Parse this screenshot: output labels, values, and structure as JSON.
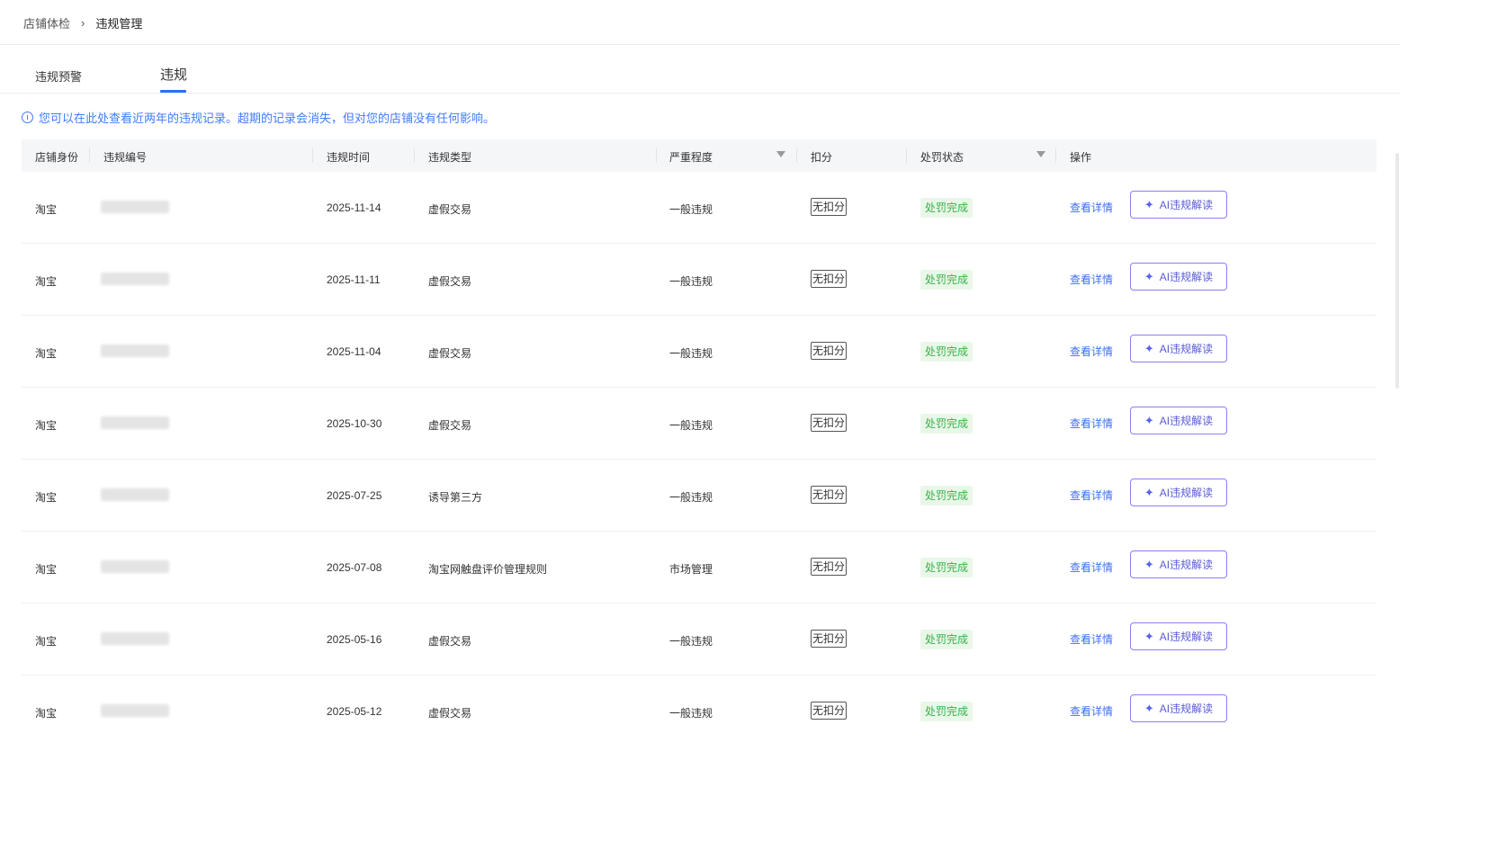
{
  "breadcrumb": {
    "parent": "店铺体检",
    "separator": "›",
    "current": "违规管理"
  },
  "tabs": [
    {
      "label": "违规预警"
    },
    {
      "label": "违规"
    }
  ],
  "notice": {
    "text": "您可以在此处查看近两年的违规记录。超期的记录会消失，但对您的店铺没有任何影响。"
  },
  "table": {
    "headers": {
      "identity": "店铺身份",
      "code": "违规编号",
      "time": "违规时间",
      "type": "违规类型",
      "severity": "严重程度",
      "points": "扣分",
      "penalty": "处罚状态",
      "action": "操作"
    },
    "rows": [
      {
        "identity": "淘宝",
        "time": "2025-11-14",
        "type": "虚假交易",
        "severity": "一般违规",
        "points": "无扣分",
        "penalty": "处罚完成",
        "detail": "查看详情",
        "ai": "AI违规解读"
      },
      {
        "identity": "淘宝",
        "time": "2025-11-11",
        "type": "虚假交易",
        "severity": "一般违规",
        "points": "无扣分",
        "penalty": "处罚完成",
        "detail": "查看详情",
        "ai": "AI违规解读"
      },
      {
        "identity": "淘宝",
        "time": "2025-11-04",
        "type": "虚假交易",
        "severity": "一般违规",
        "points": "无扣分",
        "penalty": "处罚完成",
        "detail": "查看详情",
        "ai": "AI违规解读"
      },
      {
        "identity": "淘宝",
        "time": "2025-10-30",
        "type": "虚假交易",
        "severity": "一般违规",
        "points": "无扣分",
        "penalty": "处罚完成",
        "detail": "查看详情",
        "ai": "AI违规解读"
      },
      {
        "identity": "淘宝",
        "time": "2025-07-25",
        "type": "诱导第三方",
        "severity": "一般违规",
        "points": "无扣分",
        "penalty": "处罚完成",
        "detail": "查看详情",
        "ai": "AI违规解读"
      },
      {
        "identity": "淘宝",
        "time": "2025-07-08",
        "type": "淘宝网触盘评价管理规则",
        "severity": "市场管理",
        "points": "无扣分",
        "penalty": "处罚完成",
        "detail": "查看详情",
        "ai": "AI违规解读"
      },
      {
        "identity": "淘宝",
        "time": "2025-05-16",
        "type": "虚假交易",
        "severity": "一般违规",
        "points": "无扣分",
        "penalty": "处罚完成",
        "detail": "查看详情",
        "ai": "AI违规解读"
      },
      {
        "identity": "淘宝",
        "time": "2025-05-12",
        "type": "虚假交易",
        "severity": "一般违规",
        "points": "无扣分",
        "penalty": "处罚完成",
        "detail": "查看详情",
        "ai": "AI违规解读"
      }
    ]
  },
  "colors": {
    "accent": "#2f6bff",
    "link": "#3f6ef2",
    "success_bg": "#e9f7e9",
    "success_text": "#38b24a",
    "ai_border": "#8f7cf5"
  },
  "icons": {
    "info": "info-circle-icon",
    "filter": "filter-icon",
    "sparkle": "sparkle-icon"
  }
}
